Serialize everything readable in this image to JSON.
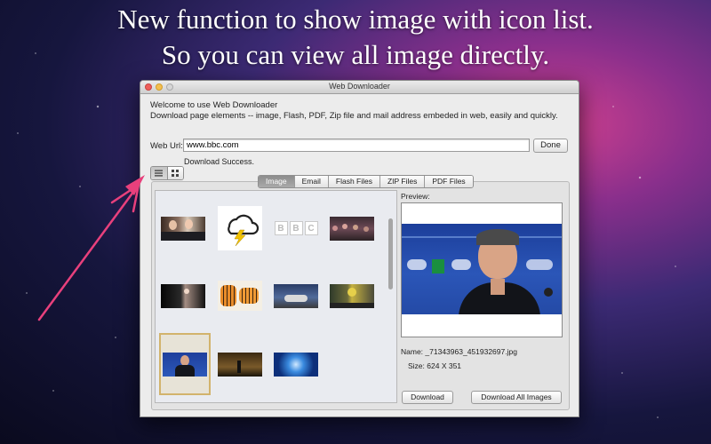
{
  "promo": {
    "line1": "New function to show image with icon list.",
    "line2": "So you can view all image directly."
  },
  "window": {
    "title": "Web Downloader",
    "welcome": "Welcome to use Web Downloader",
    "description": "Download page elements -- image, Flash, PDF, Zip file and mail address embeded in web, easily and quickly.",
    "url_label": "Web Url:",
    "url_value": "www.bbc.com",
    "done_label": "Done",
    "status": "Download Success."
  },
  "view_toggle": {
    "list_icon": "list-icon",
    "grid_icon": "grid-icon",
    "selected": "list"
  },
  "tabs": [
    {
      "label": "Image",
      "active": true
    },
    {
      "label": "Email",
      "active": false
    },
    {
      "label": "Flash Files",
      "active": false
    },
    {
      "label": "ZIP Files",
      "active": false
    },
    {
      "label": "PDF Files",
      "active": false
    }
  ],
  "thumbnails": [
    {
      "name": "people-photo"
    },
    {
      "name": "weather-storm-icon"
    },
    {
      "name": "bbc-logo",
      "text": "BBC"
    },
    {
      "name": "crowd-photo"
    },
    {
      "name": "performer-photo"
    },
    {
      "name": "tigers-photo"
    },
    {
      "name": "car-photo"
    },
    {
      "name": "rider-photo"
    },
    {
      "name": "manager-photo",
      "selected": true
    },
    {
      "name": "dark-room-photo"
    },
    {
      "name": "blue-abstract-photo"
    }
  ],
  "preview": {
    "label": "Preview:",
    "name_label": "Name:",
    "name_value": "_71343963_451932697.jpg",
    "size_label": "Size:",
    "size_value": "624 X 351"
  },
  "buttons": {
    "download": "Download",
    "download_all": "Download All Images"
  },
  "colors": {
    "arrow": "#e8407c",
    "tab_active": "#9a9a9a",
    "selection": "#d2b36c"
  }
}
